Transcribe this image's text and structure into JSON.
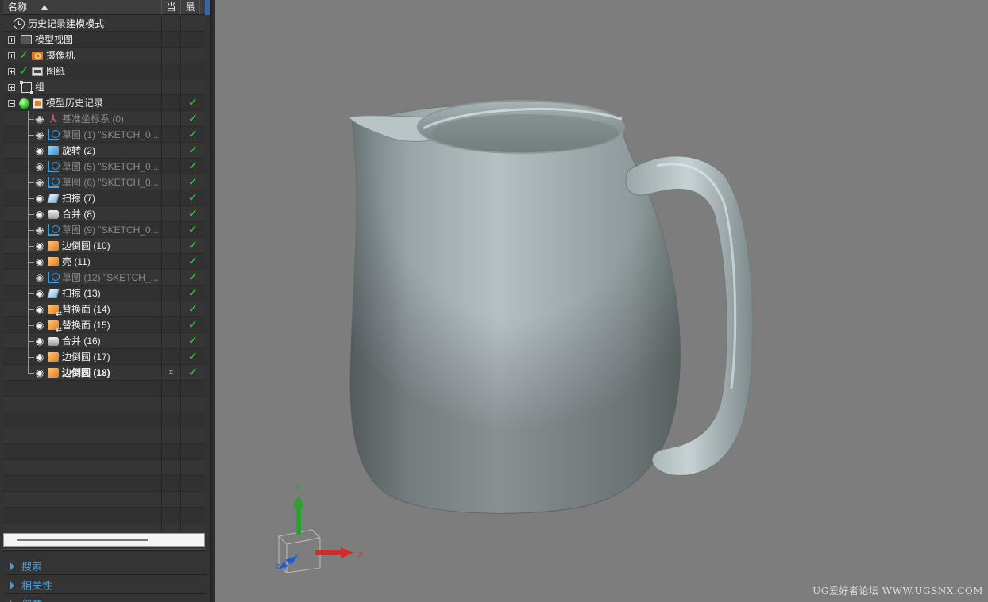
{
  "navigator": {
    "columns": {
      "name": "名称",
      "current": "当",
      "latest": "最"
    },
    "nodes": [
      {
        "label": "历史记录建模模式",
        "icon": "clock-icon"
      },
      {
        "label": "模型视图",
        "icon": "model-view-icon"
      },
      {
        "label": "摄像机",
        "icon": "camera-icon"
      },
      {
        "label": "图纸",
        "icon": "drawing-icon"
      },
      {
        "label": "组",
        "icon": "group-icon"
      },
      {
        "label": "模型历史记录",
        "icon": "model-history-icon"
      },
      {
        "label": "基准坐标系 (0)",
        "icon": "datum-csys-icon"
      },
      {
        "label": "草图 (1) \"SKETCH_0...",
        "icon": "sketch-icon"
      },
      {
        "label": "旋转 (2)",
        "icon": "revolve-icon"
      },
      {
        "label": "草图 (5) \"SKETCH_0...",
        "icon": "sketch-icon"
      },
      {
        "label": "草图 (6) \"SKETCH_0...",
        "icon": "sketch-icon"
      },
      {
        "label": "扫掠 (7)",
        "icon": "swept-icon"
      },
      {
        "label": "合并 (8)",
        "icon": "unite-icon"
      },
      {
        "label": "草图 (9) \"SKETCH_0...",
        "icon": "sketch-icon"
      },
      {
        "label": "边倒圆 (10)",
        "icon": "edge-blend-icon"
      },
      {
        "label": "壳 (11)",
        "icon": "shell-icon"
      },
      {
        "label": "草图 (12) \"SKETCH_...",
        "icon": "sketch-icon"
      },
      {
        "label": "扫掠 (13)",
        "icon": "swept-icon"
      },
      {
        "label": "替换面 (14)",
        "icon": "replace-face-icon"
      },
      {
        "label": "替换面 (15)",
        "icon": "replace-face-icon"
      },
      {
        "label": "合并 (16)",
        "icon": "unite-icon"
      },
      {
        "label": "边倒圆 (17)",
        "icon": "edge-blend-icon"
      },
      {
        "label": "边倒圆 (18)",
        "icon": "edge-blend-icon"
      }
    ],
    "sections": [
      "搜索",
      "相关性",
      "细节"
    ]
  },
  "viewport": {
    "background_color": "#7d7d7d",
    "triad": {
      "y_label": "Y",
      "x_label": "X",
      "z_label": "Z"
    },
    "watermark": "UG爱好者论坛 WWW.UGSNX.COM"
  },
  "colors": {
    "check": "#2ecc40",
    "section_link": "#3aa0e8",
    "sketch": "#2ea6e8",
    "blend": "#e07a1f"
  }
}
